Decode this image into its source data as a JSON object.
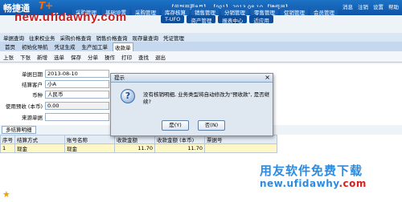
{
  "header": {
    "logo": "畅捷通",
    "logo_badge": "T+",
    "account_info": "【单到开票8月】 【001】 2013-08-10 【操作员】",
    "right_links": [
      "消息",
      "注销",
      "设置",
      "帮助"
    ],
    "menu_top": [
      "采购管理",
      "基础设置",
      "采购管理",
      "库存核算",
      "销售管理",
      "分销管理",
      "零售管理",
      "促销管理",
      "会员管理"
    ],
    "menu_bottom": [
      "T-UFO",
      "资产管理",
      "报表中心",
      "近应用"
    ]
  },
  "watermark": "new.ufidawhy.com",
  "breadcrumb": [
    "单据查询",
    "往来权业务",
    "采购价格查询",
    "销售价格查询",
    "现存量查询",
    "凭证管理"
  ],
  "tabs": [
    "首页",
    "初始化导航",
    "凭证生成",
    "生产加工单",
    "收款单"
  ],
  "active_tab": "收款单",
  "toolbar": [
    "上张",
    "下张",
    "新增",
    "选单",
    "保存",
    "分单",
    "操作",
    "打印",
    "查找",
    "退出"
  ],
  "form": {
    "date_label": "单据日期",
    "date_value": "2013-08-10",
    "customer_label": "结算客户",
    "customer_value": "小A",
    "currency_label": "币种",
    "currency_value": "人民币",
    "prepay_label": "使用预收 (本币)",
    "prepay_value": "0.00",
    "source_label": "来源单据",
    "source_value": ""
  },
  "subtab": "多结算明细",
  "grid": {
    "headers": [
      "序号",
      "结算方式",
      "账号名称",
      "收款金额",
      "收款金额 (本币)",
      "票据号"
    ],
    "rows": [
      [
        "1",
        "现金",
        "现金",
        "11.70",
        "11.70",
        ""
      ]
    ]
  },
  "dialog": {
    "title": "提示",
    "message": "没有核销明细, 业务类型将自动修改为\"预收款\", 是否继续?",
    "yes_label": "是(Y)",
    "no_label": "否(N)",
    "icon": "?"
  },
  "brand": {
    "name": "用友软件免费下载",
    "url_blue": "new.ufidawhy",
    "url_red": ".com"
  }
}
